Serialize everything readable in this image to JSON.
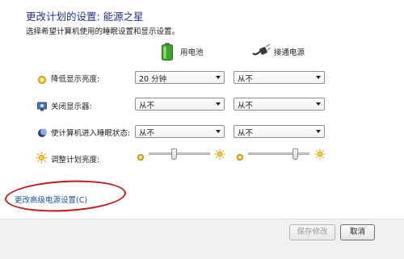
{
  "header": {
    "title": "更改计划的设置: 能源之星",
    "subtitle": "选择希望计算机使用的睡眠设置和显示设置。"
  },
  "columns": {
    "battery_label": "用电池",
    "plugged_label": "接通电源",
    "battery_icon": "battery-icon",
    "plugged_icon": "power-plug-icon"
  },
  "rows": [
    {
      "label": "降低显示亮度:",
      "icon": "dim-display-icon",
      "battery_value": "20 分钟",
      "plugged_value": "从不"
    },
    {
      "label": "关闭显示器:",
      "icon": "monitor-icon",
      "battery_value": "从不",
      "plugged_value": "从不"
    },
    {
      "label": "使计算机进入睡眠状态:",
      "icon": "sleep-moon-icon",
      "battery_value": "从不",
      "plugged_value": "从不"
    }
  ],
  "brightness": {
    "label": "调整计划亮度:",
    "icon": "brightness-sun-icon",
    "battery_level_percent": 40,
    "plugged_level_percent": 80
  },
  "advanced_link": "更改高级电源设置(C)",
  "buttons": {
    "save": "保存修改",
    "cancel": "取消"
  },
  "colors": {
    "title": "#1e3287",
    "link": "#1a4f9e",
    "annotation_ellipse": "#c0151b",
    "footer_bg": "#f0f0f0"
  }
}
